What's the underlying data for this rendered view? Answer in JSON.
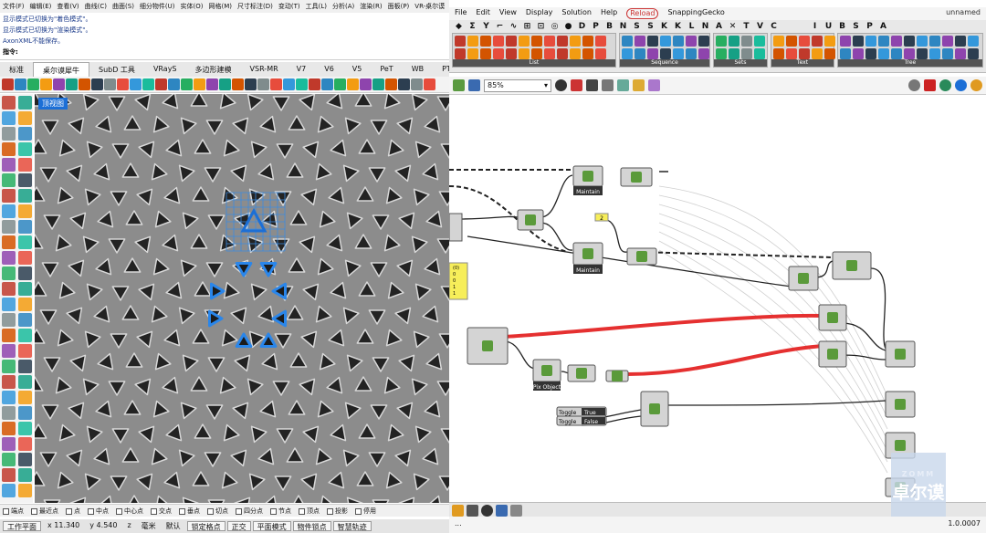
{
  "rhino": {
    "menu": [
      "文件(F)",
      "编辑(E)",
      "查看(V)",
      "曲线(C)",
      "曲面(S)",
      "细分物件(U)",
      "实体(O)",
      "网格(M)",
      "尺寸标注(D)",
      "变动(T)",
      "工具(L)",
      "分析(A)",
      "渲染(R)",
      "面板(P)",
      "VR-桌尔谟"
    ],
    "command_history": [
      "显示模式已切换为\"着色模式\"。",
      "显示模式已切换为\"渲染模式\"。",
      "AxonXML不能保存。"
    ],
    "prompt": "指令:",
    "tabs": [
      "标准",
      "桌尔谟犀牛",
      "SubD 工具",
      "VRayS",
      "多边形建模",
      "VSR-MR",
      "V7",
      "V6",
      "V5",
      "PeT",
      "WB",
      "PT"
    ],
    "active_tab": "桌尔谟犀牛",
    "viewport_label": "顶视图",
    "snaps": [
      "端点",
      "最近点",
      "点",
      "中点",
      "中心点",
      "交点",
      "垂点",
      "切点",
      "四分点",
      "节点",
      "顶点",
      "投影",
      "停用"
    ],
    "status": {
      "cplane": "工作平面",
      "x": "x 11.340",
      "y": "y 4.540",
      "z": "z",
      "unit": "毫米",
      "layer": "默认",
      "buttons": [
        "锁定格点",
        "正交",
        "平面模式",
        "物件锁点",
        "智慧轨迹"
      ]
    }
  },
  "grasshopper": {
    "menu": [
      "File",
      "Edit",
      "View",
      "Display",
      "Solution",
      "Help",
      "Reload",
      "SnappingGecko"
    ],
    "document_name": "unnamed",
    "row1": [
      "◆",
      "Σ",
      "Y",
      "⌐",
      "∿",
      "⊞",
      "⊡",
      "◎",
      "●",
      "D",
      "P",
      "B",
      "N",
      "S",
      "S",
      "K",
      "K",
      "L",
      "N",
      "A",
      "✕",
      "T",
      "V",
      "C",
      "",
      "",
      "I",
      "U",
      "B",
      "S",
      "P",
      "A"
    ],
    "panel_captions": [
      "List",
      "Sequence",
      "Sets",
      "Text",
      "Tree"
    ],
    "zoom": "85%",
    "version": "1.0.0007",
    "nodes": {
      "maintain1": "Maintain",
      "maintain2": "Maintain",
      "pixobject": "Pix Object",
      "sort": "Sort"
    },
    "toggle1": {
      "label": "Toggle",
      "value": "True"
    },
    "toggle2": {
      "label": "Toggle",
      "value": "False"
    },
    "panel_lines": [
      "(0)",
      "0",
      "0",
      "1",
      "1"
    ],
    "panel_small": "2"
  },
  "watermark": {
    "cn": "卓尔谟",
    "en": "ZOMM"
  },
  "colors": {
    "accent": "#1c6fd6",
    "red_wire": "#e53030",
    "pattern_bg": "#8c8c8c",
    "triangle": "#232323"
  }
}
